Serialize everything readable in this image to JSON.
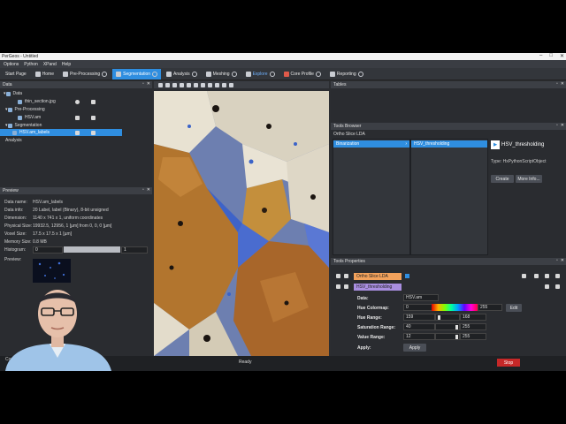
{
  "app": {
    "title": "PerGeos - Untitled",
    "window_controls": [
      "–",
      "□",
      "✕"
    ]
  },
  "menu": [
    "Options",
    "Python",
    "XPand",
    "Help"
  ],
  "toolbar": {
    "items": [
      {
        "label": "Start Page",
        "active": false
      },
      {
        "label": "Home",
        "active": false
      },
      {
        "label": "Pre-Processing",
        "active": false
      },
      {
        "label": "Segmentation",
        "active": true
      },
      {
        "label": "Analysis",
        "active": false
      },
      {
        "label": "Meshing",
        "active": false
      },
      {
        "label": "Explore",
        "active": false
      },
      {
        "label": "Core Profile",
        "active": false
      },
      {
        "label": "Reporting",
        "active": false
      }
    ]
  },
  "data_panel": {
    "title": "Data",
    "tree": [
      {
        "label": "Data",
        "level": 0
      },
      {
        "label": "thin_section.jpg",
        "level": 2
      },
      {
        "label": "Pre-Processing",
        "level": 1
      },
      {
        "label": "HSV.am",
        "level": 2
      },
      {
        "label": "Segmentation",
        "level": 1
      },
      {
        "label": "HSV.am_labels",
        "level": 2,
        "selected": true
      },
      {
        "label": "Analysis",
        "level": 1
      }
    ]
  },
  "preview_panel": {
    "title": "Preview",
    "rows": [
      {
        "k": "Data name:",
        "v": "HSV.am_labels"
      },
      {
        "k": "Data info:",
        "v": "20 Label, label (Binary), 8-bit unsigned"
      },
      {
        "k": "Dimension:",
        "v": "1140 x 741 x 1, uniform coordinates"
      },
      {
        "k": "Physical Size:",
        "v": "19932.5, 12956, 1 [µm] from 0, 0, 0 [µm]"
      },
      {
        "k": "Voxel Size:",
        "v": "17.5 x 17.5 x 1 [µm]"
      },
      {
        "k": "Memory Size:",
        "v": "0.8 MB"
      },
      {
        "k": "Histogram:",
        "v": "0"
      },
      {
        "k": "Preview:",
        "v": ""
      }
    ],
    "histogram_max": "1"
  },
  "tables_panel": {
    "title": "Tables"
  },
  "browser_panel": {
    "title": "Tools Browser",
    "breadcrumb": "Ortho Slice LDA",
    "col1_item": "Binarization",
    "col2_item": "HSV_thresholding",
    "detail_title": "HSV_thresholding",
    "detail_type": "Type: HxPythonScriptObject",
    "create_label": "Create",
    "more_info_label": "More Info..."
  },
  "props_panel": {
    "title": "Tools Properties",
    "tags": [
      "Ortho Slice LDA",
      "HSV_thresholding"
    ],
    "rows": [
      {
        "label": "Data:",
        "value": "HSV.am"
      },
      {
        "label": "Hue Colormap:",
        "min": "0",
        "max": "255",
        "edit": "Edit"
      },
      {
        "label": "Hue Range:",
        "min": "159",
        "max": "168"
      },
      {
        "label": "Saturation Range:",
        "min": "40",
        "max": "255"
      },
      {
        "label": "Value Range:",
        "min": "12",
        "max": "255"
      },
      {
        "label": "Apply:",
        "button": "Apply"
      }
    ]
  },
  "status": {
    "text": "Ready",
    "console": "Cons",
    "red_button": "Stop"
  },
  "colors": {
    "accent": "#2f8ee0",
    "panel": "#2a2c30",
    "tag_orange": "#f2a25c",
    "tag_purple": "#a98ee0",
    "stop_red": "#c62828"
  }
}
